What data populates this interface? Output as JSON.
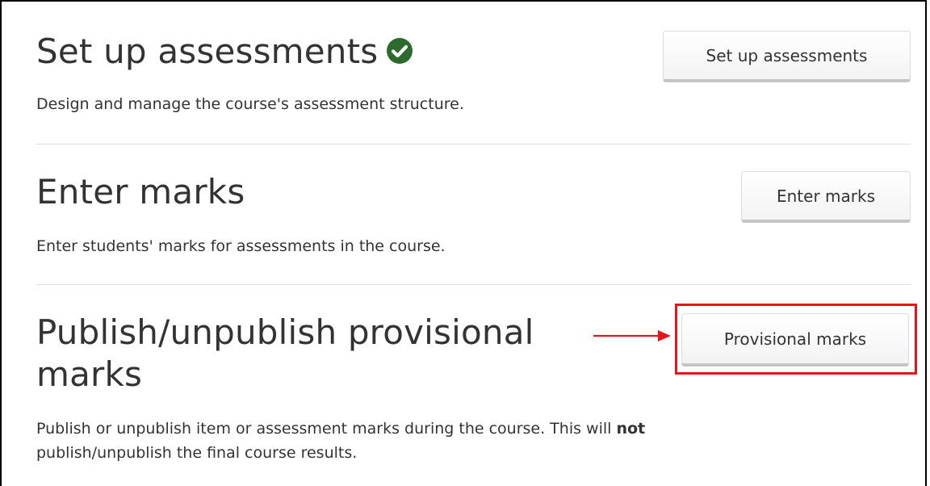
{
  "sections": [
    {
      "title": "Set up assessments",
      "description": "Design and manage the course's assessment structure.",
      "button_label": "Set up assessments",
      "status_icon": "check-circle-icon"
    },
    {
      "title": "Enter marks",
      "description": "Enter students' marks for assessments in the course.",
      "button_label": "Enter marks"
    },
    {
      "title_line1": "Publish/unpublish provisional",
      "title_line2": "marks",
      "description_part1": "Publish or unpublish item or assessment marks during the course. This will ",
      "description_bold": "not",
      "description_part2": "publish/unpublish the final course results.",
      "button_label": "Provisional marks",
      "annotation_icon": "arrow-right-icon"
    }
  ],
  "colors": {
    "text": "#333333",
    "check_icon": "#2d6a2e",
    "annotation_red": "#e8141c",
    "divider": "#dcdcdc"
  }
}
